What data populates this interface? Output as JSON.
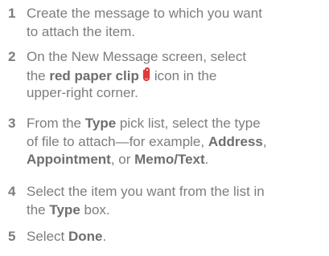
{
  "steps": [
    {
      "number": "1",
      "lines": [
        [
          {
            "t": "Create the message to which you want",
            "b": false
          }
        ],
        [
          {
            "t": "to attach the item.",
            "b": false
          }
        ]
      ]
    },
    {
      "number": "2",
      "lines": [
        [
          {
            "t": "On the New Message screen, select",
            "b": false
          }
        ],
        [
          {
            "t": "the ",
            "b": false
          },
          {
            "t": "red paper clip",
            "b": true
          },
          {
            "icon": "paper-clip-icon"
          },
          {
            "t": "icon in the",
            "b": false
          }
        ],
        [
          {
            "t": "upper-right corner.",
            "b": false
          }
        ]
      ]
    },
    {
      "number": "3",
      "lines": [
        [
          {
            "t": "From the ",
            "b": false
          },
          {
            "t": "Type",
            "b": true
          },
          {
            "t": " pick list, select the type",
            "b": false
          }
        ],
        [
          {
            "t": "of file to attach—for example, ",
            "b": false
          },
          {
            "t": "Address",
            "b": true
          },
          {
            "t": ",",
            "b": false
          }
        ],
        [
          {
            "t": "Appointment",
            "b": true
          },
          {
            "t": ", or ",
            "b": false
          },
          {
            "t": "Memo/Text",
            "b": true
          },
          {
            "t": ".",
            "b": false
          }
        ]
      ]
    },
    {
      "number": "4",
      "lines": [
        [
          {
            "t": "Select the item you want from the list in",
            "b": false
          }
        ],
        [
          {
            "t": "the ",
            "b": false
          },
          {
            "t": "Type",
            "b": true
          },
          {
            "t": " box.",
            "b": false
          }
        ]
      ]
    },
    {
      "number": "5",
      "lines": [
        [
          {
            "t": "Select ",
            "b": false
          },
          {
            "t": "Done",
            "b": true
          },
          {
            "t": ".",
            "b": false
          }
        ]
      ]
    }
  ],
  "colors": {
    "text": "#7d7d7d",
    "bold_text": "#6e6e6e",
    "clip_icon": "#e03a3a"
  }
}
